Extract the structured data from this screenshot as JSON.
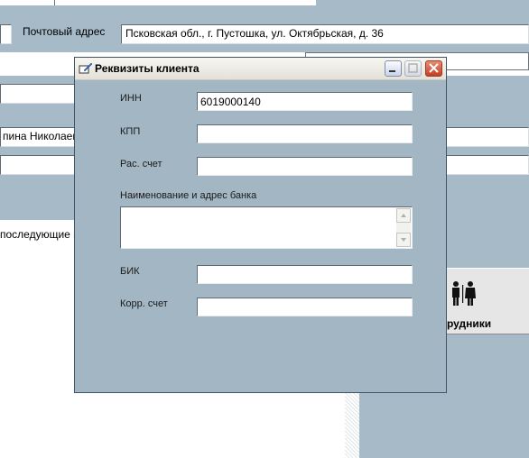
{
  "background_form": {
    "postal_address_label": "Почтовый адрес",
    "postal_address_value": "Псковская обл., г. Пустошка, ул. Октябрьская, д. 36",
    "partial_name_text": "пина Николаев",
    "partial_notes_text": "последующие в",
    "employees_button_label": "рудники"
  },
  "dialog": {
    "title": "Реквизиты клиента",
    "inn_label": "ИНН",
    "inn_value": "6019000140",
    "kpp_label": "КПП",
    "kpp_value": "",
    "account_label": "Рас. счет",
    "account_value": "",
    "bank_label": "Наименование и адрес банка",
    "bank_value": "",
    "bik_label": "БИК",
    "bik_value": "",
    "corr_label": "Корр. счет",
    "corr_value": ""
  },
  "colors": {
    "panel": "#a6bac8",
    "dialog": "#a2b6c4",
    "close_button": "#c44024"
  },
  "icons": [
    "edit-icon",
    "minimize-icon",
    "maximize-icon",
    "close-icon",
    "people-icon",
    "scroll-up-icon",
    "scroll-down-icon"
  ]
}
